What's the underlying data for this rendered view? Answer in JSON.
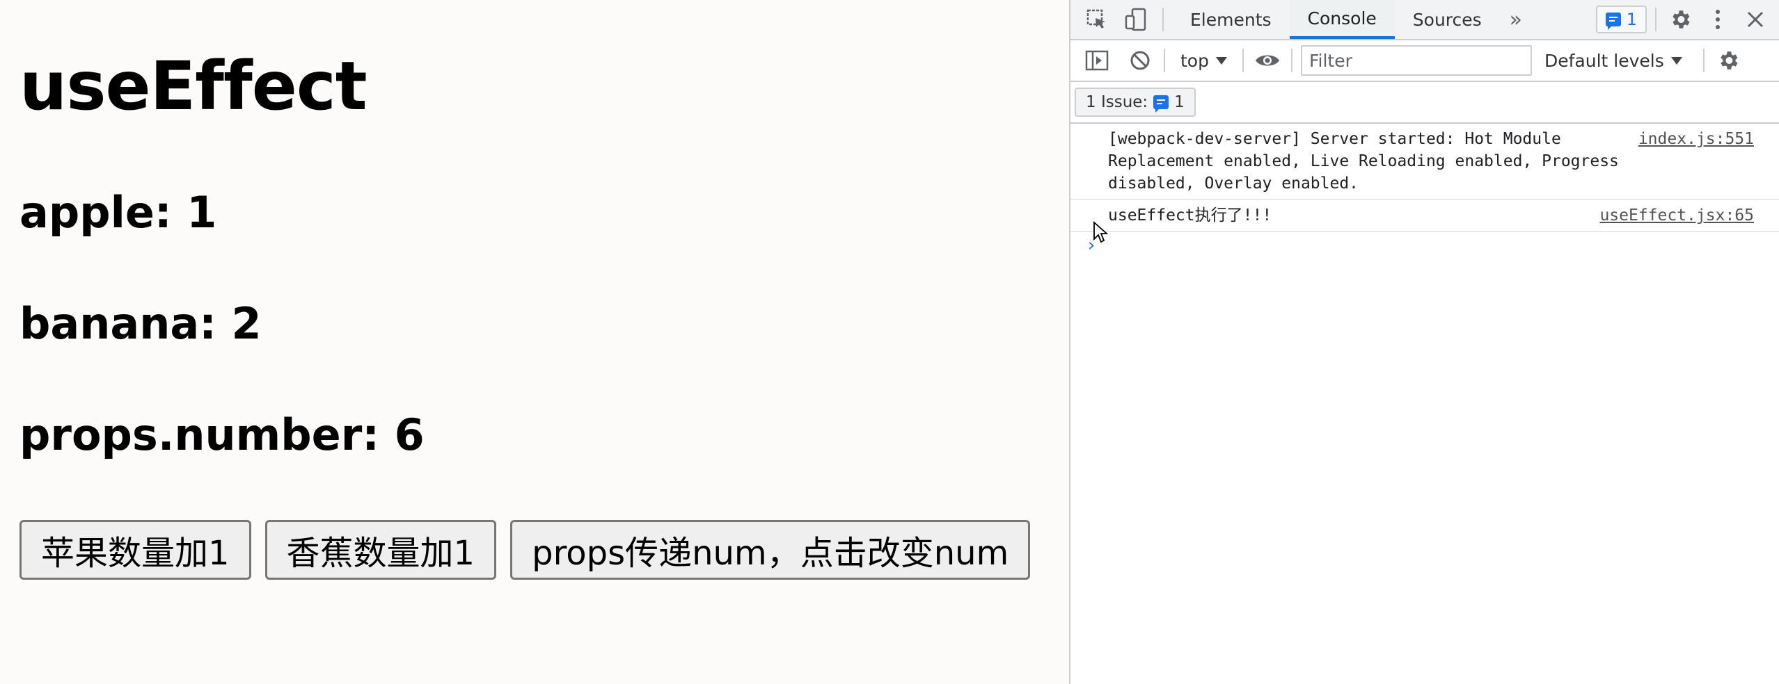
{
  "page": {
    "title": "useEffect",
    "apple_line": "apple: 1",
    "banana_line": "banana: 2",
    "props_line": "props.number: 6",
    "buttons": {
      "apple": "苹果数量加1",
      "banana": "香蕉数量加1",
      "props": "props传递num，点击改变num"
    }
  },
  "devtools": {
    "tabs": [
      "Elements",
      "Console",
      "Sources"
    ],
    "active_tab": "Console",
    "issues_badge_count": "1",
    "toolbar": {
      "context": "top",
      "filter_placeholder": "Filter",
      "levels": "Default levels"
    },
    "issues_bar": {
      "label": "1 Issue:",
      "count": "1"
    },
    "console_logs": [
      {
        "text": "[webpack-dev-server] Server started: Hot Module\nReplacement enabled, Live Reloading enabled, Progress\ndisabled, Overlay enabled.",
        "source": "index.js:551"
      },
      {
        "text": "useEffect执行了!!!",
        "source": "useEffect.jsx:65"
      }
    ],
    "prompt": "›"
  },
  "colors": {
    "accent": "#1a73e8",
    "page_bg": "#fcfbfa",
    "button_bg": "#efefef",
    "button_border": "#767676"
  }
}
